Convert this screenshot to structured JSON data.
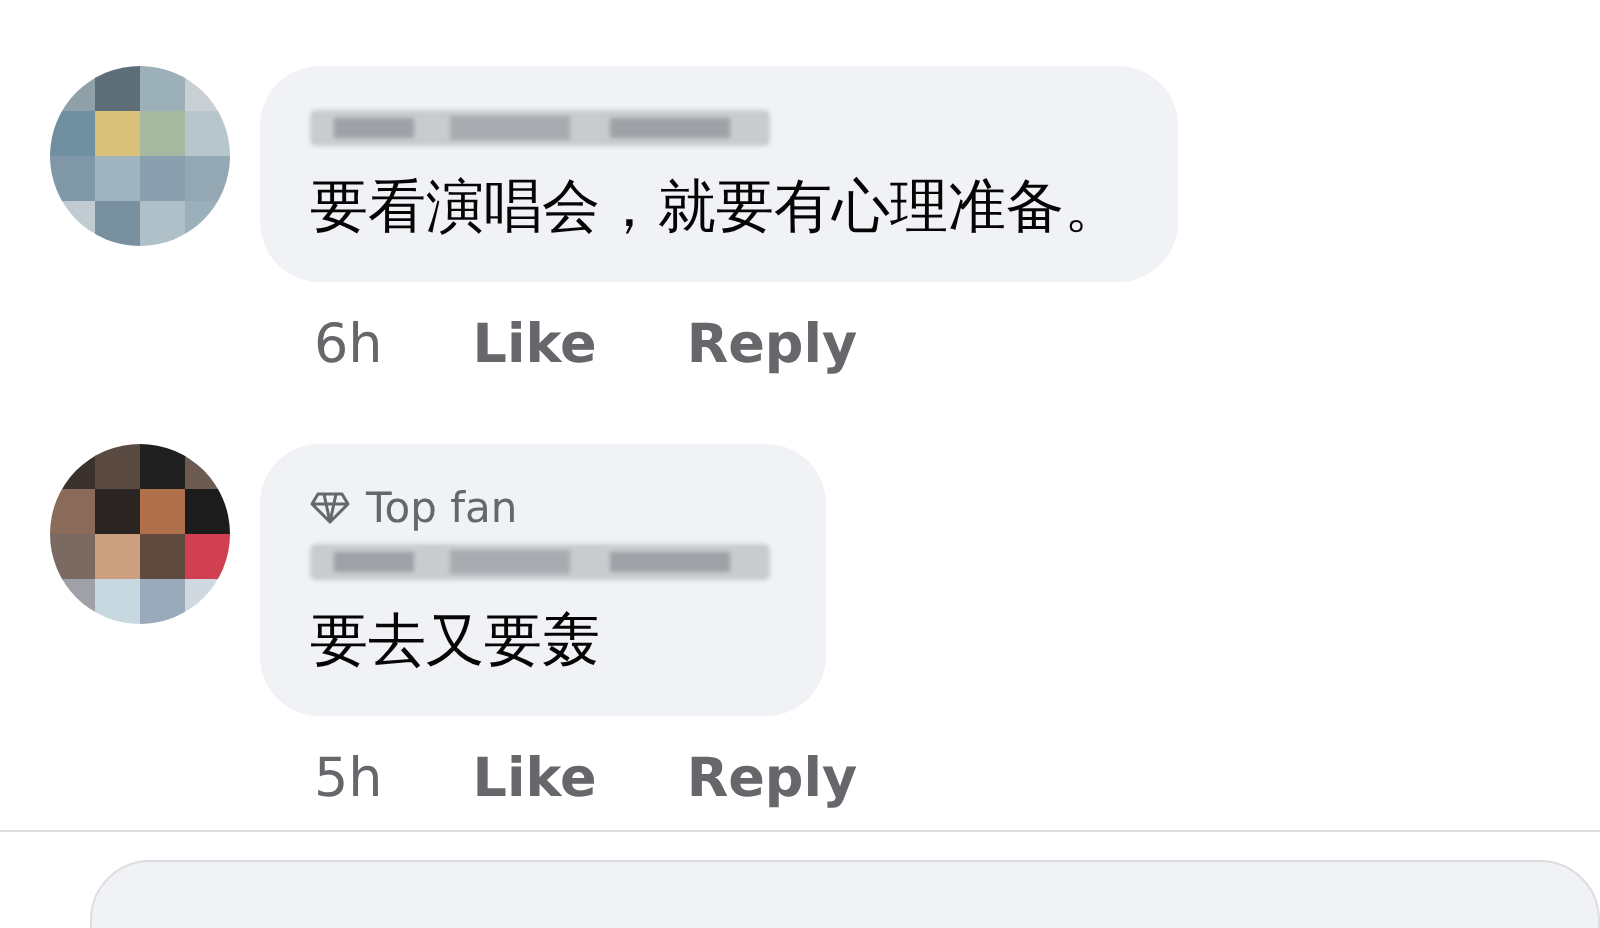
{
  "comments": [
    {
      "text": "要看演唱会，就要有心理准备。",
      "time": "6h",
      "actions": [
        "Like",
        "Reply"
      ]
    },
    {
      "badge": "Top fan",
      "text": "要去又要轰",
      "time": "5h",
      "actions": [
        "Like",
        "Reply"
      ]
    }
  ]
}
